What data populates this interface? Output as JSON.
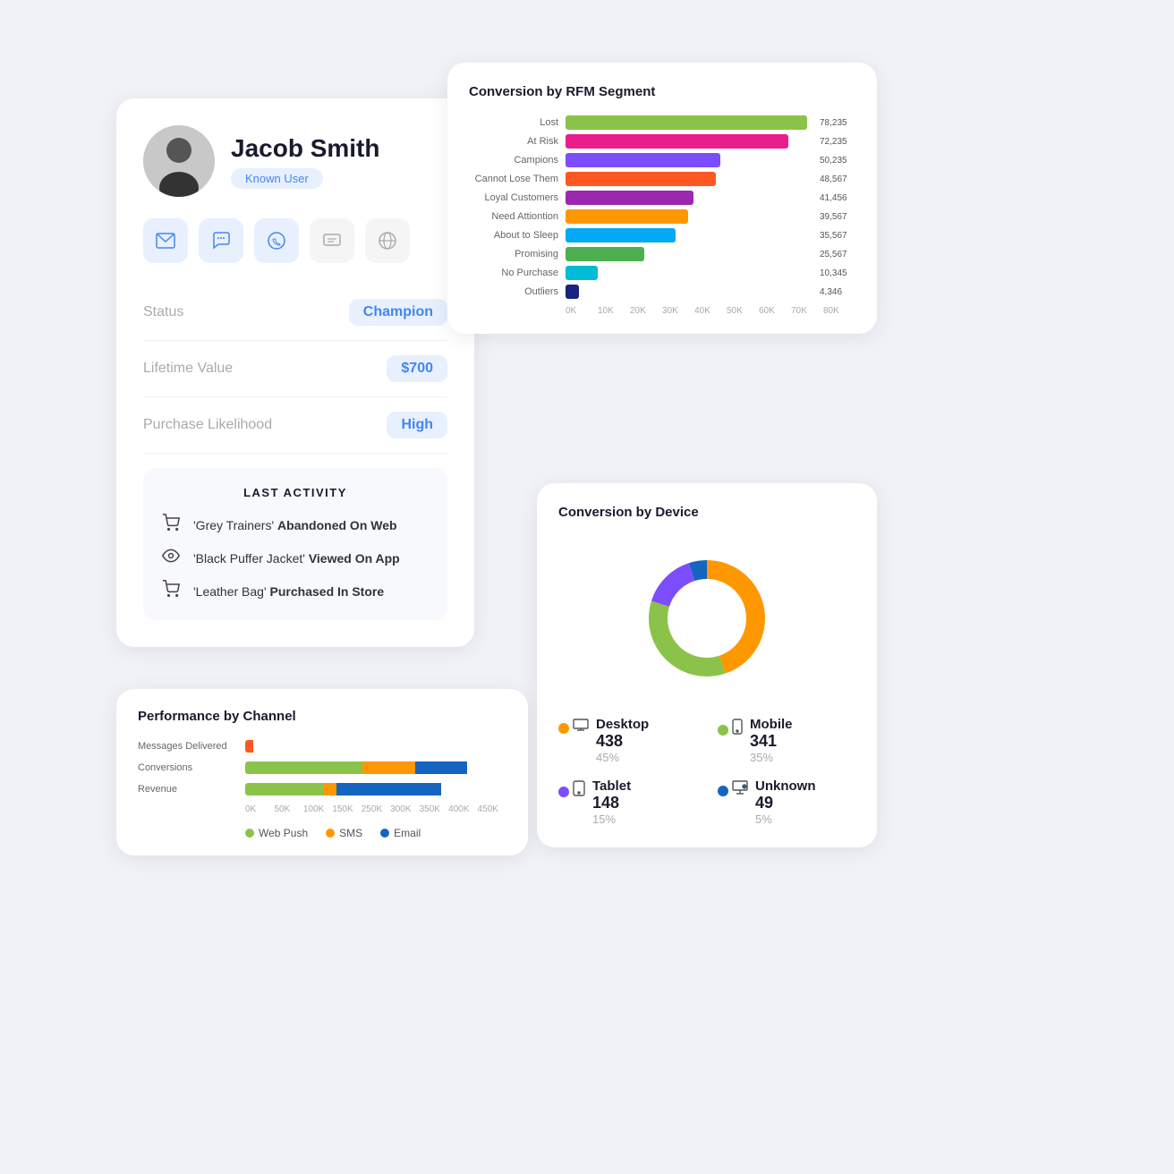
{
  "profile": {
    "name": "Jacob Smith",
    "badge": "Known User",
    "status_label": "Status",
    "status_value": "Champion",
    "lifetime_label": "Lifetime Value",
    "lifetime_value": "$700",
    "likelihood_label": "Purchase Likelihood",
    "likelihood_value": "High"
  },
  "channels": [
    {
      "id": "email",
      "icon": "✉",
      "label": "Email",
      "active": true
    },
    {
      "id": "chat",
      "icon": "💬",
      "label": "Chat",
      "active": true
    },
    {
      "id": "whatsapp",
      "icon": "📱",
      "label": "WhatsApp",
      "active": true
    },
    {
      "id": "sms",
      "icon": "📋",
      "label": "SMS",
      "active": false
    },
    {
      "id": "web",
      "icon": "🌐",
      "label": "Web",
      "active": false
    }
  ],
  "last_activity": {
    "title": "LAST ACTIVITY",
    "items": [
      {
        "icon": "🛒",
        "text_prefix": "'Grey Trainers'",
        "text_action": "Abandoned On Web"
      },
      {
        "icon": "👁",
        "text_prefix": "'Black Puffer Jacket'",
        "text_action": "Viewed On App"
      },
      {
        "icon": "🛒",
        "text_prefix": "'Leather Bag'",
        "text_action": "Purchased In Store"
      }
    ]
  },
  "rfm": {
    "title": "Conversion by RFM Segment",
    "segments": [
      {
        "label": "Lost",
        "value": 78235,
        "color": "#8bc34a",
        "max": 80000
      },
      {
        "label": "At Risk",
        "value": 72235,
        "color": "#e91e8c",
        "max": 80000
      },
      {
        "label": "Campions",
        "value": 50235,
        "color": "#7c4dff",
        "max": 80000
      },
      {
        "label": "Cannot Lose Them",
        "value": 48567,
        "color": "#ff5722",
        "max": 80000
      },
      {
        "label": "Loyal Customers",
        "value": 41456,
        "color": "#9c27b0",
        "max": 80000
      },
      {
        "label": "Need Attiontion",
        "value": 39567,
        "color": "#ff9800",
        "max": 80000
      },
      {
        "label": "About to Sleep",
        "value": 35567,
        "color": "#03a9f4",
        "max": 80000
      },
      {
        "label": "Promising",
        "value": 25567,
        "color": "#4caf50",
        "max": 80000
      },
      {
        "label": "No Purchase",
        "value": 10345,
        "color": "#00bcd4",
        "max": 80000
      },
      {
        "label": "Outliers",
        "value": 4346,
        "color": "#1a237e",
        "max": 80000
      }
    ],
    "x_axis": [
      "0K",
      "10K",
      "20K",
      "30K",
      "40K",
      "50K",
      "60K",
      "70K",
      "80K"
    ]
  },
  "device": {
    "title": "Conversion by Device",
    "segments": [
      {
        "name": "Desktop",
        "count": 438,
        "pct": "45%",
        "color": "#ff9800",
        "angle": 162
      },
      {
        "name": "Mobile",
        "count": 341,
        "pct": "35%",
        "color": "#8bc34a",
        "angle": 126
      },
      {
        "name": "Tablet",
        "count": 148,
        "pct": "15%",
        "color": "#7c4dff",
        "angle": 54
      },
      {
        "name": "Unknown",
        "count": 49,
        "pct": "5%",
        "color": "#1565c0",
        "angle": 18
      }
    ]
  },
  "performance": {
    "title": "Performance by Channel",
    "rows": [
      {
        "label": "Messages Delivered",
        "segments": [
          {
            "color": "#ff5722",
            "pct": 3
          }
        ]
      },
      {
        "label": "Conversions",
        "segments": [
          {
            "color": "#8bc34a",
            "pct": 45
          },
          {
            "color": "#ff9800",
            "pct": 20
          },
          {
            "color": "#1565c0",
            "pct": 20
          }
        ]
      },
      {
        "label": "Revenue",
        "segments": [
          {
            "color": "#8bc34a",
            "pct": 30
          },
          {
            "color": "#ff9800",
            "pct": 5
          },
          {
            "color": "#1565c0",
            "pct": 40
          }
        ]
      }
    ],
    "x_axis": [
      "0K",
      "50K",
      "100K",
      "150K",
      "250K",
      "300K",
      "350K",
      "400K",
      "450K"
    ],
    "legend": [
      {
        "label": "Web Push",
        "color": "#8bc34a"
      },
      {
        "label": "SMS",
        "color": "#ff9800"
      },
      {
        "label": "Email",
        "color": "#1565c0"
      }
    ]
  }
}
